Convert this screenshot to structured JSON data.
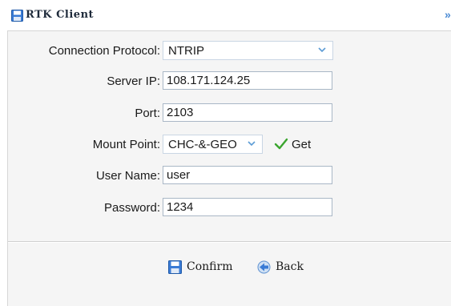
{
  "window": {
    "title": "RTK Client",
    "close_glyph": "»"
  },
  "form": {
    "connection_protocol": {
      "label": "Connection Protocol:",
      "value": "NTRIP"
    },
    "server_ip": {
      "label": "Server IP:",
      "value": "108.171.124.25"
    },
    "port": {
      "label": "Port:",
      "value": "2103"
    },
    "mount_point": {
      "label": "Mount Point:",
      "value": "CHC-&-GEO",
      "get_label": "Get"
    },
    "user_name": {
      "label": "User Name:",
      "value": "user"
    },
    "password": {
      "label": "Password:",
      "value": "1234"
    }
  },
  "actions": {
    "confirm_label": "Confirm",
    "back_label": "Back"
  },
  "colors": {
    "accent": "#3a7bd5",
    "field_border": "#a9b7c6",
    "panel_bg": "#f5f5f5",
    "check_green": "#3aa52e"
  },
  "icons": {
    "title": "floppy-disk-icon",
    "confirm": "floppy-disk-icon",
    "back": "back-arrow-icon",
    "get": "checkmark-icon",
    "dropdown": "chevron-down-icon"
  }
}
